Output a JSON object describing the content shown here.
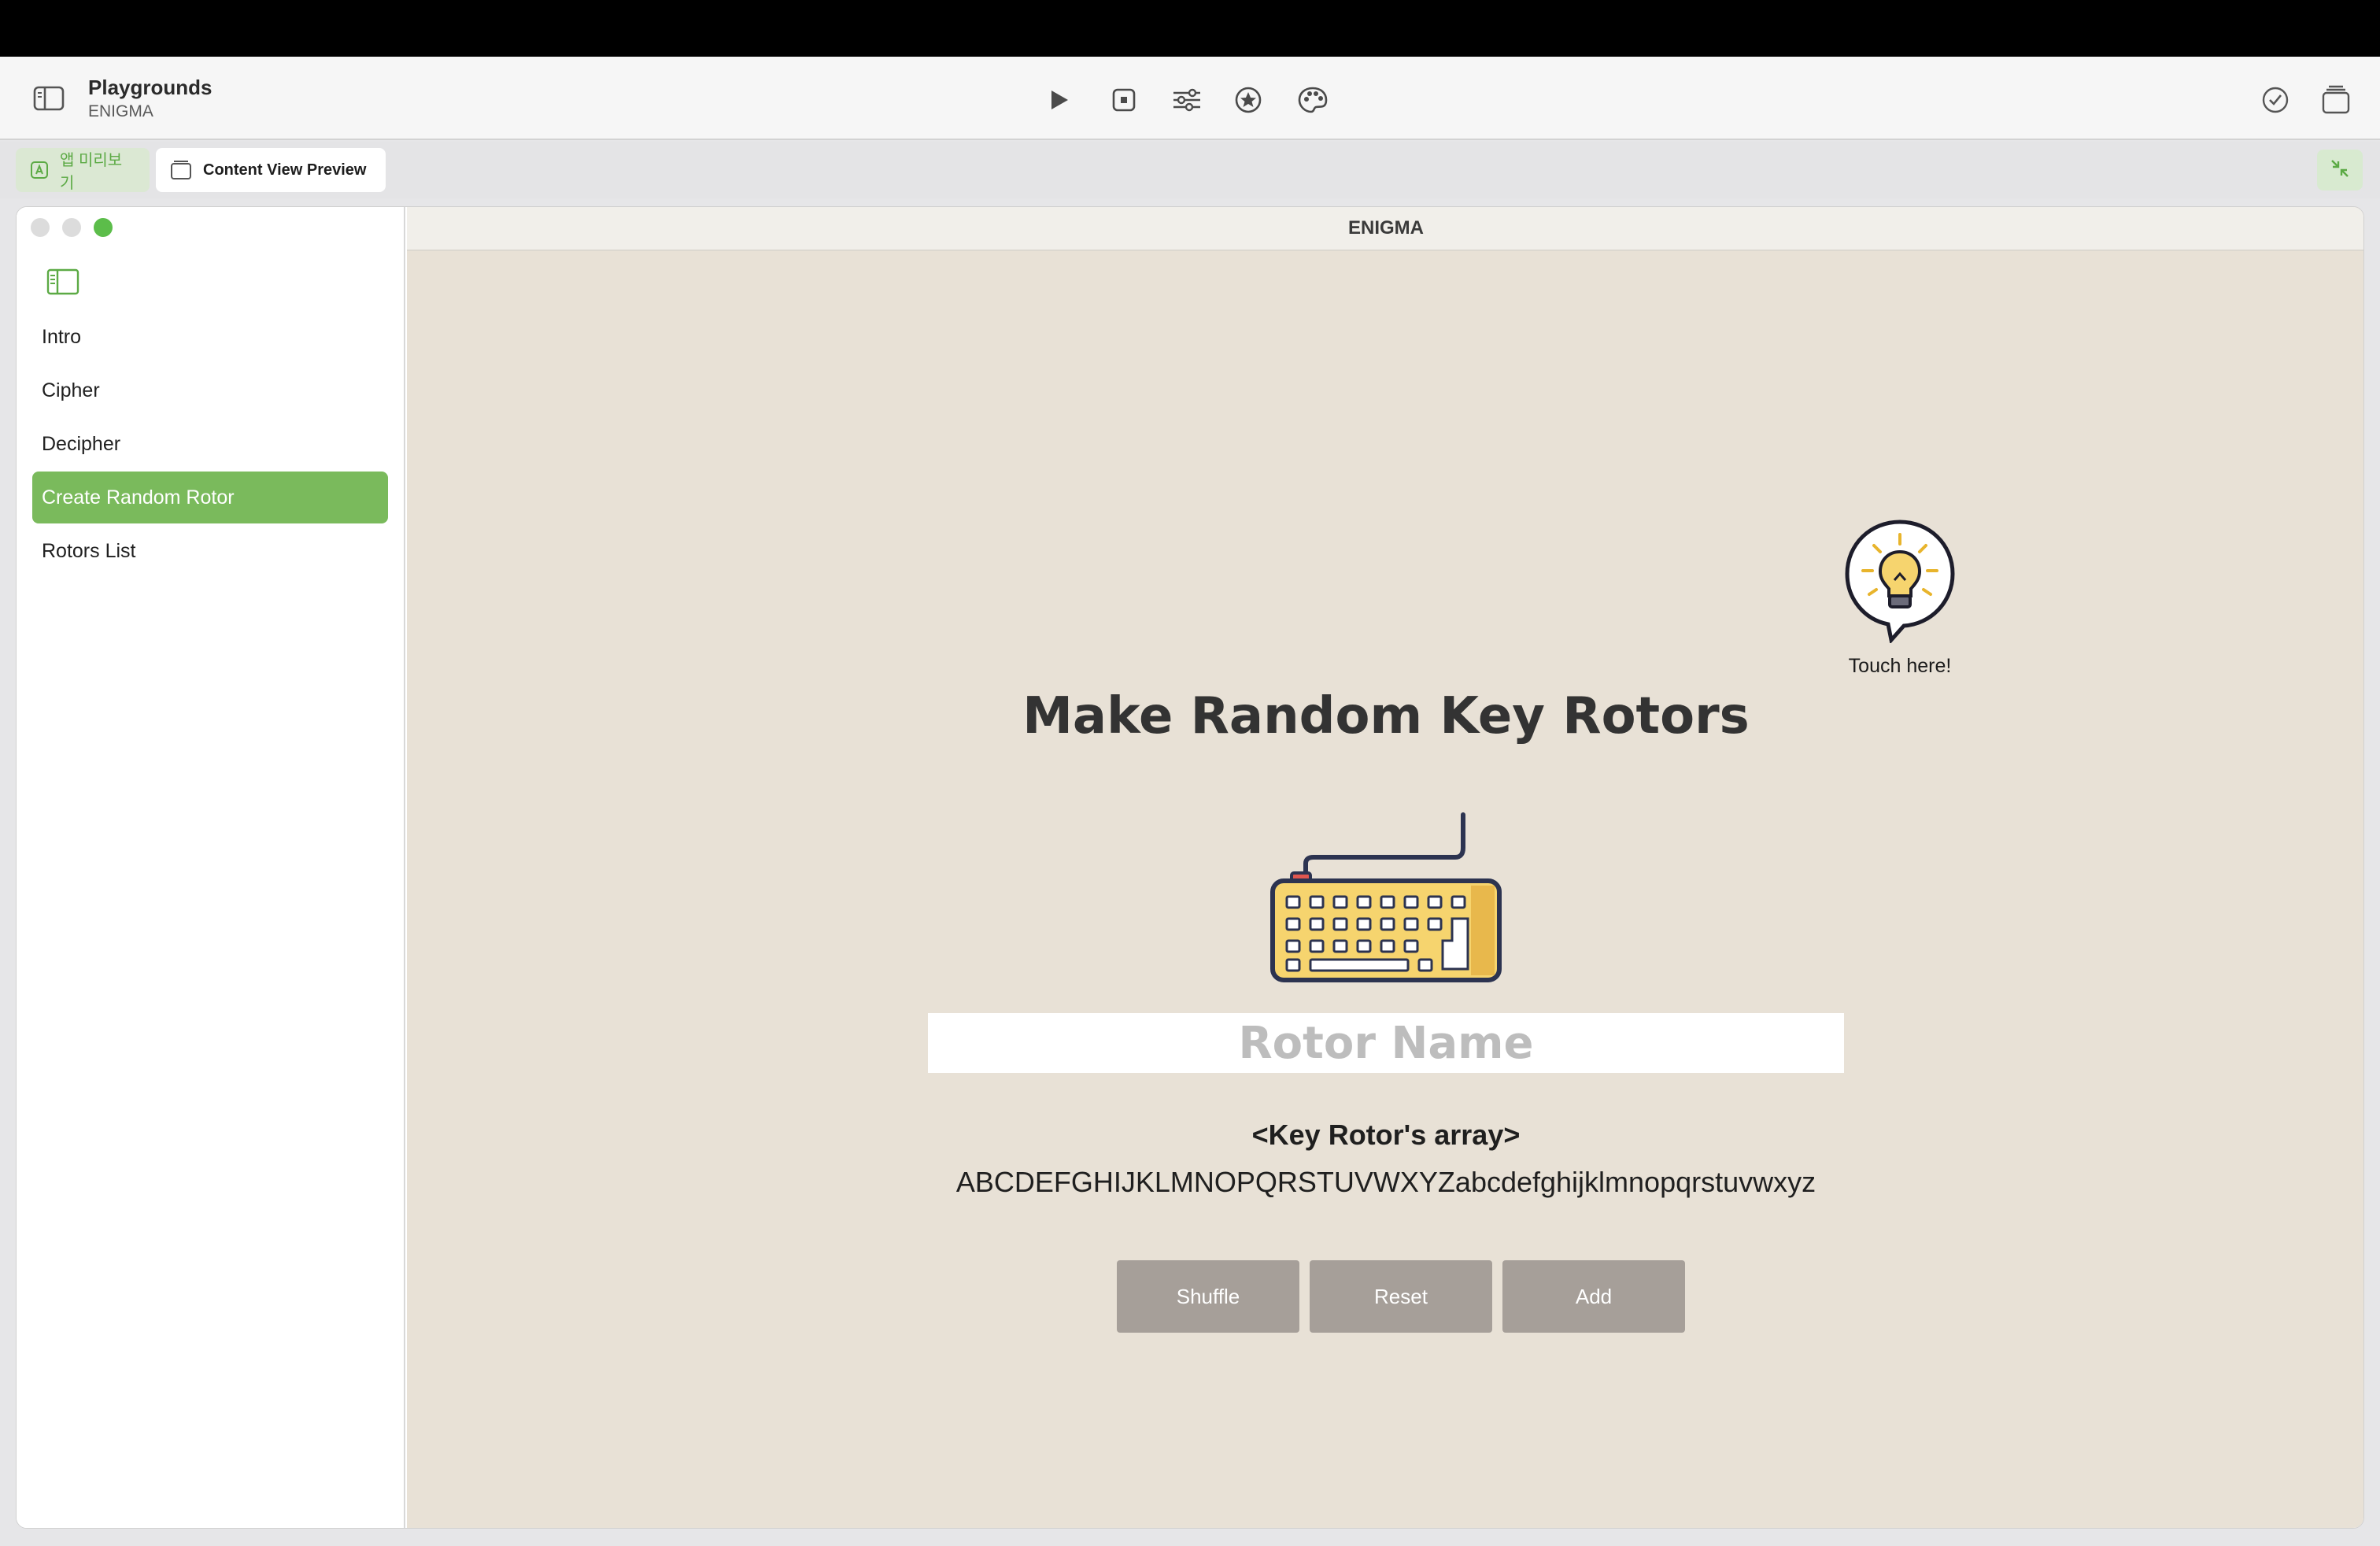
{
  "toolbar": {
    "app_title": "Playgrounds",
    "app_subtitle": "ENIGMA"
  },
  "tabs": {
    "app_preview": "앱 미리보기",
    "content_view_preview": "Content View Preview"
  },
  "sidebar": {
    "items": [
      {
        "label": "Intro"
      },
      {
        "label": "Cipher"
      },
      {
        "label": "Decipher"
      },
      {
        "label": "Create Random Rotor",
        "selected": true
      },
      {
        "label": "Rotors List"
      }
    ]
  },
  "content": {
    "window_title": "ENIGMA",
    "headline": "Make Random Key Rotors",
    "hint_label": "Touch here!",
    "name_placeholder": "Rotor Name",
    "array_label": "<Key Rotor's array>",
    "array_value": "ABCDEFGHIJKLMNOPQRSTUVWXYZabcdefghijklmnopqrstuvwxyz",
    "buttons": {
      "shuffle": "Shuffle",
      "reset": "Reset",
      "add": "Add"
    }
  },
  "colors": {
    "accent_green": "#7aba5c",
    "content_bg": "#e8e1d6",
    "button_bg": "#a69f99"
  },
  "icons": {
    "toolbar": [
      "sidebar-toggle-icon",
      "play-icon",
      "stop-icon",
      "sliders-icon",
      "star-icon",
      "palette-icon",
      "checkmark-icon",
      "windows-icon"
    ],
    "content": [
      "lightbulb-icon",
      "keyboard-icon"
    ]
  }
}
